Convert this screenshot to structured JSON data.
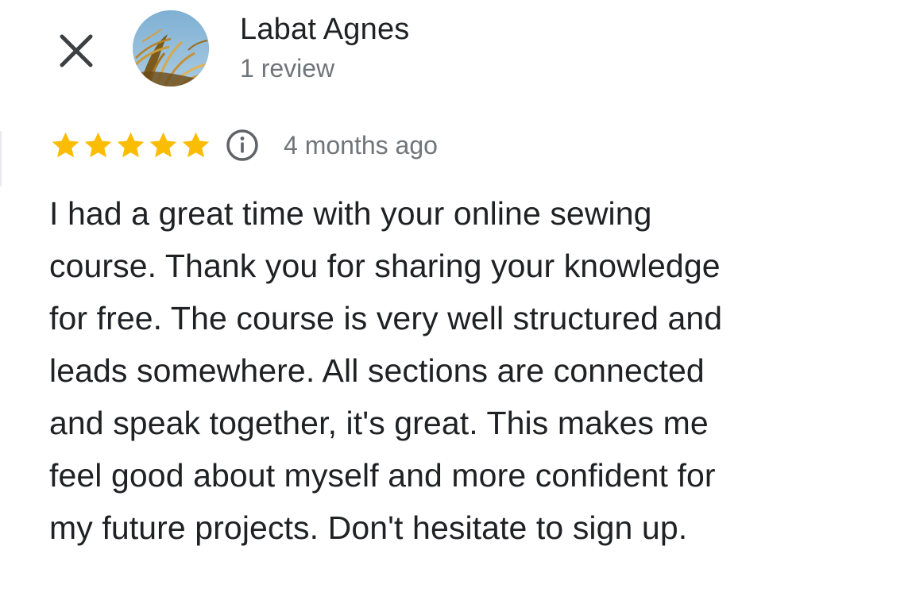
{
  "header": {
    "close_icon": "close-icon",
    "avatar_icon": "profile-photo-palm-leaves"
  },
  "reviewer": {
    "name": "Labat Agnes",
    "review_count": "1 review"
  },
  "rating": {
    "stars": 5,
    "max_stars": 5,
    "star_color": "#fbbc04",
    "info_icon": "info-icon",
    "time_ago": "4 months ago"
  },
  "review": {
    "lines": [
      "I had a great time with your online sewing",
      "course. Thank you for sharing your knowledge",
      "for free. The course is very well structured and",
      "leads somewhere. All sections are connected",
      "and speak together, it's great. This makes me",
      "feel good about myself and more confident for",
      "my future projects. Don't hesitate to sign up."
    ]
  }
}
